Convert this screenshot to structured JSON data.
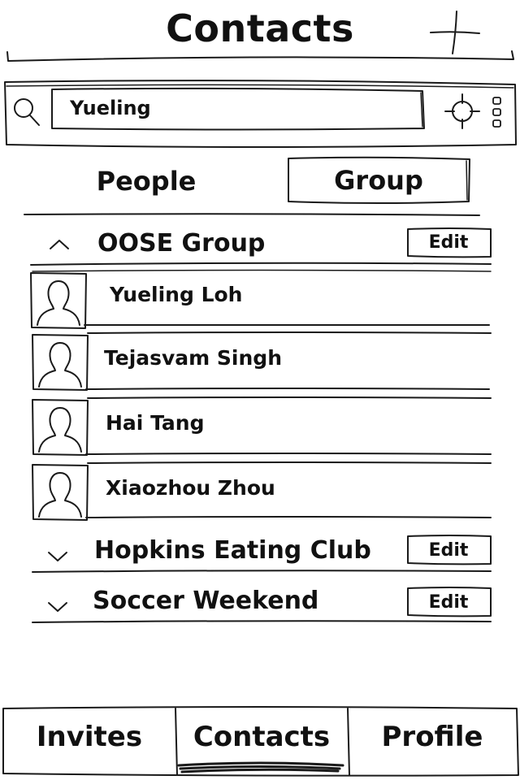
{
  "header": {
    "title": "Contacts",
    "add_icon": "plus-icon"
  },
  "search": {
    "value": "Yueling",
    "placeholder": "",
    "search_icon": "magnifier-icon",
    "locate_icon": "crosshair-icon",
    "more_icon": "vertical-dots-icon"
  },
  "segments": {
    "people_label": "People",
    "group_label": "Group",
    "selected": "Group"
  },
  "groups": [
    {
      "name": "OOSE Group",
      "expanded": true,
      "edit_label": "Edit",
      "members": [
        {
          "name": "Yueling Loh"
        },
        {
          "name": "Tejasvam Singh"
        },
        {
          "name": "Hai Tang"
        },
        {
          "name": "Xiaozhou Zhou"
        }
      ]
    },
    {
      "name": "Hopkins Eating Club",
      "expanded": false,
      "edit_label": "Edit"
    },
    {
      "name": "Soccer Weekend",
      "expanded": false,
      "edit_label": "Edit"
    }
  ],
  "tabbar": {
    "items": [
      {
        "label": "Invites"
      },
      {
        "label": "Contacts"
      },
      {
        "label": "Profile"
      }
    ],
    "selected": "Contacts"
  },
  "colors": {
    "ink": "#1a1a1a",
    "background": "#ffffff"
  }
}
